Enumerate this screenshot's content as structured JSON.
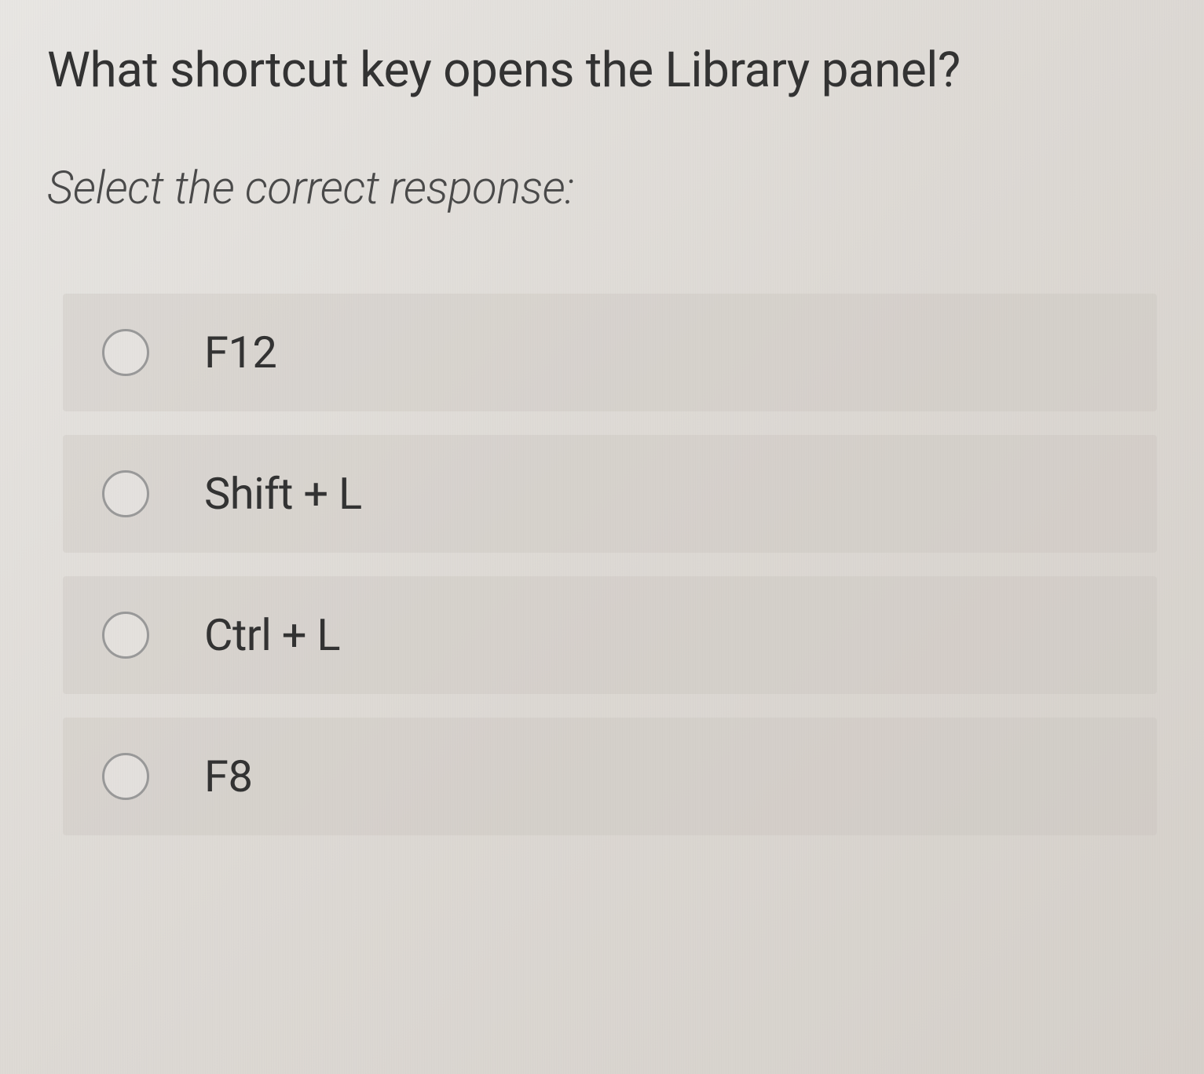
{
  "question": "What shortcut key opens the Library panel?",
  "instruction": "Select the correct response:",
  "options": [
    {
      "label": "F12"
    },
    {
      "label": "Shift + L"
    },
    {
      "label": "Ctrl + L"
    },
    {
      "label": "F8"
    }
  ]
}
